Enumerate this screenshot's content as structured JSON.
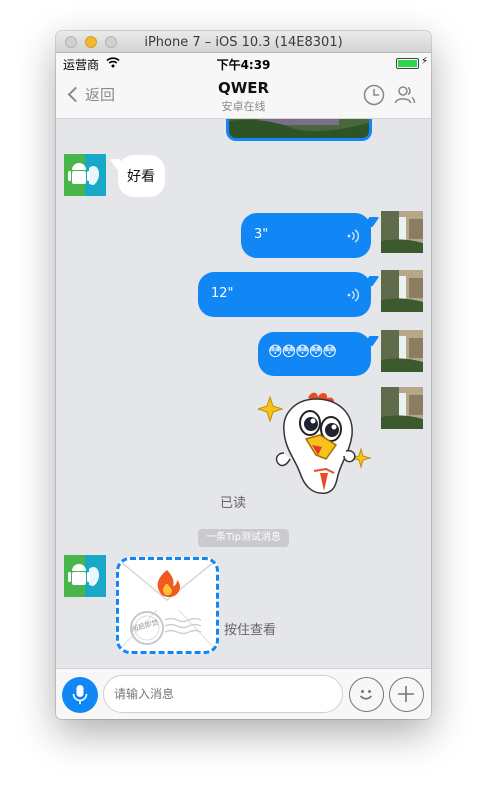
{
  "window": {
    "title": "iPhone 7 – iOS 10.3 (14E8301)"
  },
  "status_bar": {
    "carrier": "运营商",
    "time": "下午4:39",
    "battery_level": 1.0
  },
  "nav": {
    "back_label": "返回",
    "title": "QWER",
    "subtitle": "安卓在线"
  },
  "messages": {
    "text_in": "好看",
    "voice_1": "3\"",
    "voice_2": "12\"",
    "emoji_out": "😳😳😳😳😳",
    "read_status": "已读",
    "tip": "一条Tip测试消息",
    "hold_view": "按住查看",
    "envelope_stamp": "阅后即焚"
  },
  "input": {
    "placeholder": "请输入消息"
  },
  "colors": {
    "bubble_out": "#1087f5",
    "bubble_in": "#ffffff",
    "chat_bg": "#e5e6ea",
    "accent": "#1087f5"
  }
}
